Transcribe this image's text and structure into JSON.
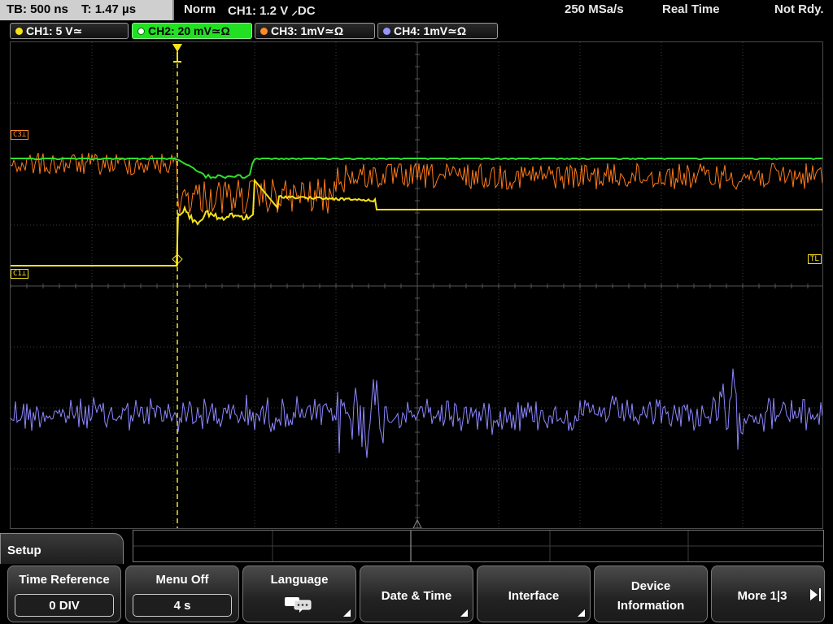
{
  "status": {
    "timebase": "TB: 500 ns",
    "trigger_time": "T: 1.47 µs",
    "mode": "Norm",
    "trigger_level": "CH1: 1.2 V ⸝DC",
    "sample_rate": "250 MSa/s",
    "acq_mode": "Real Time",
    "ready_state": "Not Rdy."
  },
  "channels": [
    {
      "label": "CH1: 5 V≃",
      "color": "#f5e21a",
      "active": false
    },
    {
      "label": "CH2: 20 mV≃Ω",
      "color": "#2ee02e",
      "active": true
    },
    {
      "label": "CH3: 1mV≃Ω",
      "color": "#ff8a2a",
      "active": false
    },
    {
      "label": "CH4: 1mV≃Ω",
      "color": "#9a94ff",
      "active": false
    }
  ],
  "markers": {
    "ch3_ref": "C3⊥",
    "ch1_ref": "C1⊥",
    "trigger_level": "TL"
  },
  "colors": {
    "ch1": "#f5e21a",
    "ch2": "#2ee02e",
    "ch3": "#ff7a1a",
    "ch4": "#8d86ff",
    "grid": "#3c3c3c"
  },
  "menu": {
    "title": "Setup",
    "softkeys": [
      {
        "label": "Time Reference",
        "value": "0 DIV"
      },
      {
        "label": "Menu Off",
        "value": "4 s"
      },
      {
        "label": "Language",
        "icon": "speech-bubble-icon"
      },
      {
        "label": "Date & Time"
      },
      {
        "label": "Interface"
      },
      {
        "label_line1": "Device",
        "label_line2": "Information"
      },
      {
        "label": "More 1|3"
      }
    ]
  }
}
